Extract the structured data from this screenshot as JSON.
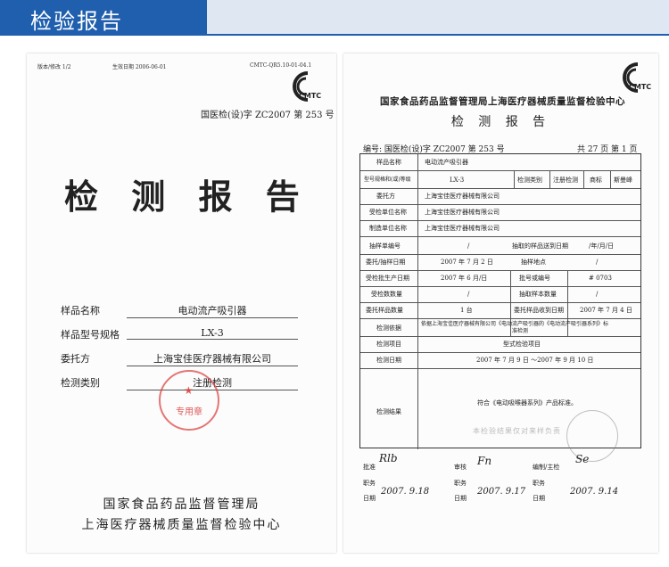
{
  "banner": {
    "title": "检验报告"
  },
  "cover": {
    "version": "版本/修改 1/2",
    "effective_date": "生效日期 2006-06-01",
    "form_code": "CMTC-QR5.10-01-04.1",
    "logo_text": "CMTC",
    "ref": "国医检(设)字 ZC2007 第 253 号",
    "title": "检 测 报 告",
    "fields": [
      {
        "label": "样品名称",
        "value": "电动流产吸引器"
      },
      {
        "label": "样品型号规格",
        "value": "LX-3"
      },
      {
        "label": "委托方",
        "value": "上海宝佳医疗器械有限公司"
      },
      {
        "label": "检测类别",
        "value": "注册检测"
      }
    ],
    "stamp": "专用章",
    "footer_line1": "国家食品药品监督管理局",
    "footer_line2": "上海医疗器械质量监督检验中心"
  },
  "report": {
    "logo_text": "CMTC",
    "header": "国家食品药品监督管理局上海医疗器械质量监督检验中心",
    "subtitle": "检 测 报 告",
    "number": "编号: 国医检(设)字 ZC2007 第 253 号",
    "pages": "共 27 页  第 1 页",
    "sample_name_label": "样品名称",
    "sample_name": "电动流产吸引器",
    "model_label": "型号规格和(或)等级",
    "model": "LX-3",
    "category_label": "检测类别",
    "category": "注册检测",
    "trademark_label": "商标",
    "trademark": "斯曼峰",
    "client_label": "委托方",
    "client": "上海宝佳医疗器械有限公司",
    "inspected_unit_label": "受检单位名称",
    "inspected_unit": "上海宝佳医疗器械有限公司",
    "maker_label": "制造单位名称",
    "maker": "上海宝佳医疗器械有限公司",
    "sample_no_label": "抽样单编号",
    "sample_no": "/",
    "received_date_label": "抽取的样品送到日期",
    "received_date": "/年/月/日",
    "sample_date_label": "委托/抽样日期",
    "sample_date": "2007 年 7 月 2 日",
    "sample_place_label": "抽样地点",
    "sample_place": "/",
    "prod_date_label": "受检批生产日期",
    "prod_date": "2007 年 6 月/日",
    "batch_label": "批号或编号",
    "batch": "# 0703",
    "qty_label": "受检数数量",
    "qty": "/",
    "base_label": "抽取样本数量",
    "base": "/",
    "delivered_label": "委托样品数量",
    "delivered": "1 台",
    "delivered_date_label": "委托样品收到日期",
    "delivered_date": "2007 年 7 月 4 日",
    "basis_label": "检测依据",
    "basis_line1": "依据上海宝佳医疗器械有限公司《电动流产吸引器的《电动流产吸引器系列》标",
    "basis_line2": "准检测",
    "items_label": "检测项目",
    "items": "型式检验项目",
    "test_date_label": "检测日期",
    "test_date": "2007 年 7 月 9 日 ～2007 年 9 月 10 日",
    "result_label": "检测结果",
    "result": "符合《电动吸喉器系列》产品标准。",
    "watermark": "本检验结果仅对来样负责",
    "sign": {
      "approve_label": "批准",
      "post_label": "职务",
      "date_label": "日期",
      "review_label": "审核",
      "compile_label": "编制/主检",
      "date1": "2007. 9.18",
      "date2": "2007. 9.17",
      "date3": "2007. 9.14"
    }
  }
}
